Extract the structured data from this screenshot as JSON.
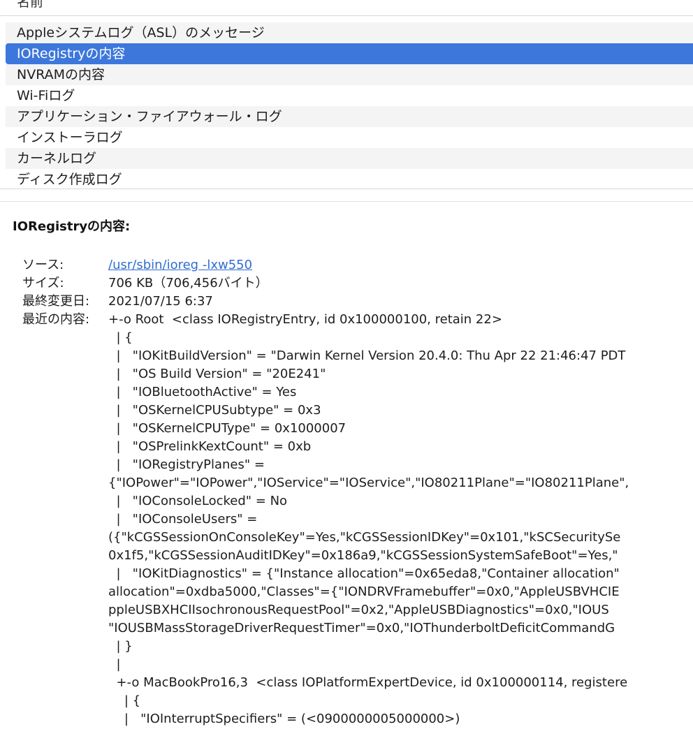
{
  "list": {
    "column_header": "名前",
    "items": [
      {
        "label": "Appleシステムログ（ASL）のメッセージ",
        "selected": false
      },
      {
        "label": "IORegistryの内容",
        "selected": true
      },
      {
        "label": "NVRAMの内容",
        "selected": false
      },
      {
        "label": "Wi-Fiログ",
        "selected": false
      },
      {
        "label": "アプリケーション・ファイアウォール・ログ",
        "selected": false
      },
      {
        "label": "インストーラログ",
        "selected": false
      },
      {
        "label": "カーネルログ",
        "selected": false
      },
      {
        "label": "ディスク作成ログ",
        "selected": false
      }
    ]
  },
  "detail": {
    "title": "IORegistryの内容:",
    "source_label": "ソース:",
    "source_value": "/usr/sbin/ioreg -lxw550",
    "size_label": "サイズ:",
    "size_value": "706 KB（706,456バイト）",
    "modified_label": "最終変更日:",
    "modified_value": "2021/07/15 6:37",
    "recent_label": "最近の内容:",
    "content_lines": [
      "+-o Root  <class IORegistryEntry, id 0x100000100, retain 22>",
      "  | {",
      "  |   \"IOKitBuildVersion\" = \"Darwin Kernel Version 20.4.0: Thu Apr 22 21:46:47 PDT",
      "  |   \"OS Build Version\" = \"20E241\"",
      "  |   \"IOBluetoothActive\" = Yes",
      "  |   \"OSKernelCPUSubtype\" = 0x3",
      "  |   \"OSKernelCPUType\" = 0x1000007",
      "  |   \"OSPrelinkKextCount\" = 0xb",
      "  |   \"IORegistryPlanes\" =",
      "{\"IOPower\"=\"IOPower\",\"IOService\"=\"IOService\",\"IO80211Plane\"=\"IO80211Plane\",",
      "  |   \"IOConsoleLocked\" = No",
      "  |   \"IOConsoleUsers\" =",
      "({\"kCGSSessionOnConsoleKey\"=Yes,\"kCGSSessionIDKey\"=0x101,\"kSCSecuritySe",
      "0x1f5,\"kCGSSessionAuditIDKey\"=0x186a9,\"kCGSSessionSystemSafeBoot\"=Yes,\"",
      "  |   \"IOKitDiagnostics\" = {\"Instance allocation\"=0x65eda8,\"Container allocation\"",
      "allocation\"=0xdba5000,\"Classes\"={\"IONDRVFramebuffer\"=0x0,\"AppleUSBVHCIE",
      "ppleUSBXHCIIsochronousRequestPool\"=0x2,\"AppleUSBDiagnostics\"=0x0,\"IOUS",
      "\"IOUSBMassStorageDriverRequestTimer\"=0x0,\"IOThunderboltDeficitCommandG",
      "  | }",
      "  |",
      "  +-o MacBookPro16,3  <class IOPlatformExpertDevice, id 0x100000114, registere",
      "    | {",
      "    |   \"IOInterruptSpecifiers\" = (<0900000005000000>)"
    ]
  }
}
